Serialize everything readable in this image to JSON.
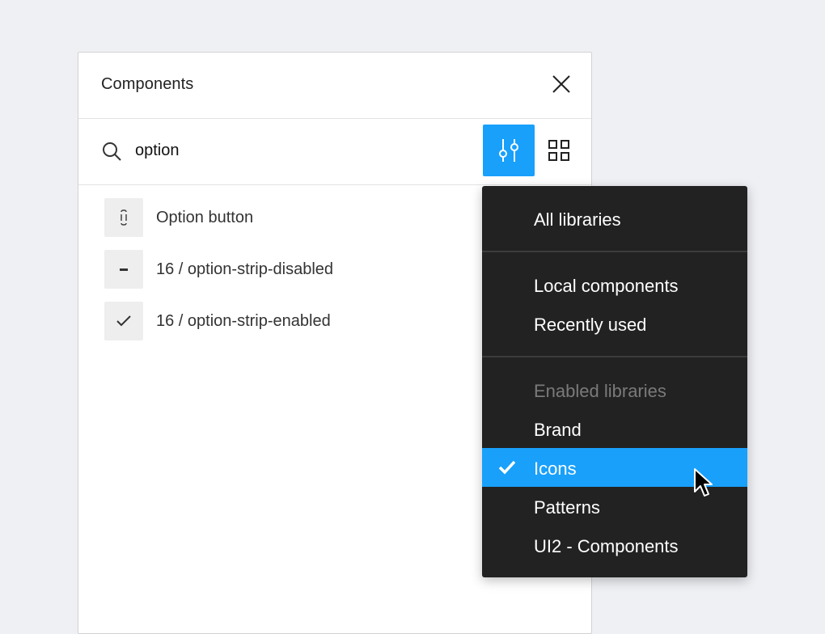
{
  "panel": {
    "title": "Components"
  },
  "search": {
    "value": "option",
    "placeholder": ""
  },
  "results": [
    {
      "label": "Option button",
      "icon": "option-button-icon"
    },
    {
      "label": "16 / option-strip-disabled",
      "icon": "minus-icon"
    },
    {
      "label": "16 / option-strip-enabled",
      "icon": "check-icon"
    }
  ],
  "menu": {
    "all_libraries": "All libraries",
    "local_components": "Local components",
    "recently_used": "Recently used",
    "enabled_libraries_header": "Enabled libraries",
    "libraries": [
      {
        "label": "Brand",
        "selected": false
      },
      {
        "label": "Icons",
        "selected": true
      },
      {
        "label": "Patterns",
        "selected": false
      },
      {
        "label": "UI2 - Components",
        "selected": false
      }
    ]
  },
  "colors": {
    "accent": "#18a0fb",
    "menu_bg": "#222222",
    "page_bg": "#eff0f4"
  }
}
